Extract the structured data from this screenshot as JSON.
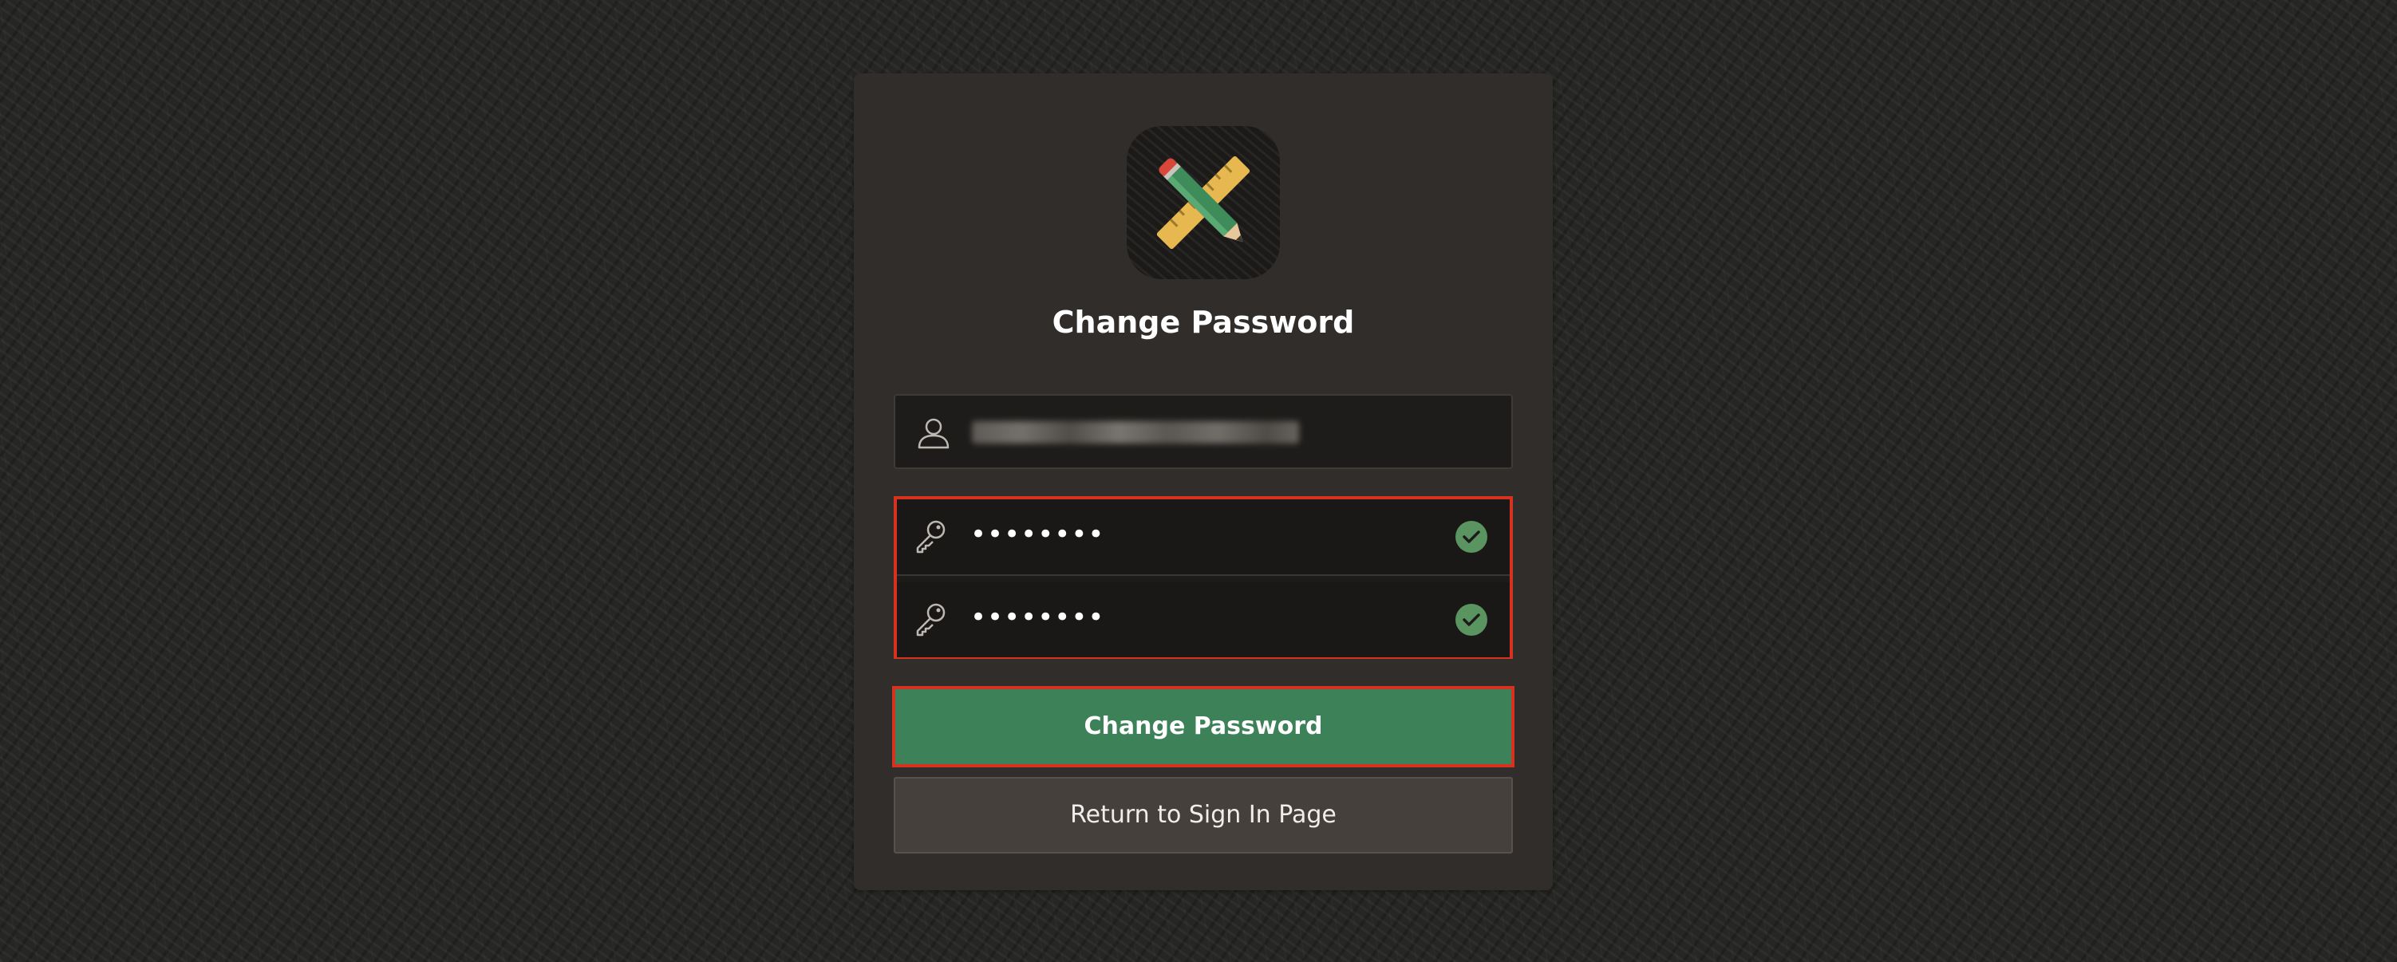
{
  "page": {
    "title": "Change Password"
  },
  "form": {
    "username": {
      "value_obscured": true,
      "icon": "user-icon"
    },
    "new_password": {
      "masked_value": "••••••••",
      "valid": true,
      "icon": "key-icon"
    },
    "confirm_password": {
      "masked_value": "••••••••",
      "valid": true,
      "icon": "key-icon"
    }
  },
  "actions": {
    "submit_label": "Change Password",
    "return_label": "Return to Sign In Page"
  },
  "colors": {
    "primary_button": "#3d8158",
    "highlight_border": "#d6321f",
    "valid_check": "#5a9460",
    "card_background": "#312d2a"
  },
  "logo": {
    "icon": "pencil-ruler-icon"
  }
}
